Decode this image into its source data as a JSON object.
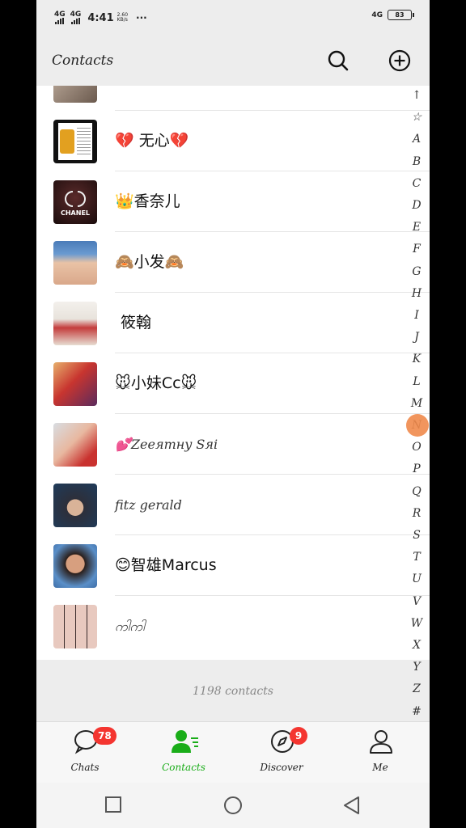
{
  "status_bar": {
    "network_1": "4G",
    "network_2": "4G",
    "time": "4:41",
    "speed_value": "2.60",
    "speed_unit": "KB/s",
    "more": "···",
    "right_network": "4G",
    "battery": "83"
  },
  "header": {
    "title": "Contacts",
    "search_icon": "search-icon",
    "add_icon": "plus-circle-icon"
  },
  "contacts": [
    {
      "name": "💔 无心💔",
      "style": "normal"
    },
    {
      "name": "👑香奈儿",
      "style": "normal",
      "avatar_text": "CHANEL"
    },
    {
      "name": "🙈小发🙈",
      "style": "normal"
    },
    {
      "name": "筱翰",
      "style": "normal"
    },
    {
      "name": "🐭小妹Cc🐭",
      "style": "normal"
    },
    {
      "name": "💕Zeeятнy Sяi",
      "style": "script"
    },
    {
      "name": "fitz gerald",
      "style": "script"
    },
    {
      "name": "😊智雄Marcus",
      "style": "normal"
    },
    {
      "name": "ကါကါ",
      "style": "script"
    }
  ],
  "index_letters": [
    "↑",
    "☆",
    "A",
    "B",
    "C",
    "D",
    "E",
    "F",
    "G",
    "H",
    "I",
    "J",
    "K",
    "L",
    "M",
    "N",
    "O",
    "P",
    "Q",
    "R",
    "S",
    "T",
    "U",
    "V",
    "W",
    "X",
    "Y",
    "Z",
    "#"
  ],
  "footer": {
    "count_text": "1198 contacts"
  },
  "tabs": [
    {
      "label": "Chats",
      "icon": "chat-bubble-icon",
      "badge": "78"
    },
    {
      "label": "Contacts",
      "icon": "contacts-icon",
      "badge": ""
    },
    {
      "label": "Discover",
      "icon": "compass-icon",
      "badge": "9"
    },
    {
      "label": "Me",
      "icon": "person-icon",
      "badge": ""
    }
  ],
  "colors": {
    "accent": "#1aad19",
    "badge": "#f43530",
    "background": "#ededed"
  },
  "system_nav": [
    "recents-button",
    "home-button",
    "back-button"
  ]
}
